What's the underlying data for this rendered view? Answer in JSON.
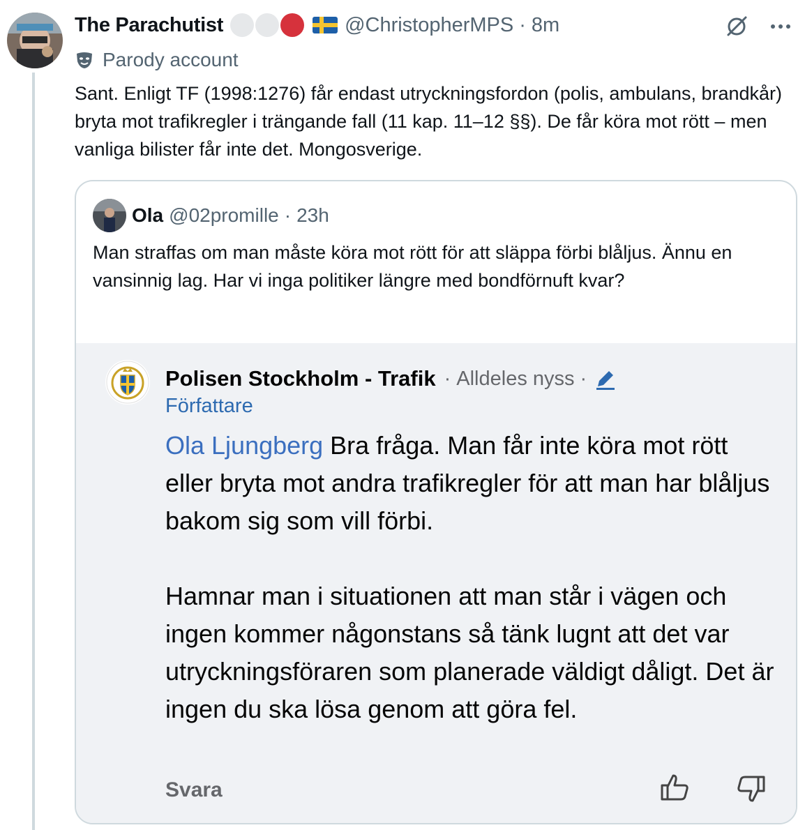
{
  "tweet": {
    "display_name": "The Parachutist",
    "handle": "@ChristopherMPS",
    "separator": "·",
    "time": "8m",
    "parody_label": "Parody account",
    "text": "Sant. Enligt TF (1998:1276) får endast utryckningsfordon (polis, ambulans, brandkår) bryta mot trafikregler i trängande fall (11 kap. 11–12 §§). De får köra mot rött  – men vanliga bilister får inte det. Mongosverige."
  },
  "quoted": {
    "display_name": "Ola",
    "handle": "@02promille",
    "separator": "·",
    "time": "23h",
    "text": "Man straffas om man måste köra mot rött för att släppa förbi blåljus. Ännu en vansinnig lag. Har vi inga politiker längre med bondförnuft kvar?"
  },
  "embedded_comment": {
    "author": "Polisen Stockholm - Trafik",
    "separator": "·",
    "time": "Alldeles nyss",
    "separator2": "·",
    "author_badge": "Författare",
    "mention": "Ola Ljungberg",
    "text_p1": " Bra fråga. Man får inte köra mot rött eller bryta mot andra trafikregler för att man har blåljus bakom sig som vill förbi.",
    "text_p2": "Hamnar man i situationen att man står i vägen och ingen kommer någonstans så tänk lugnt att det var utryckningsföraren som planerade väldigt dåligt. Det är ingen du ska lösa genom att göra fel.",
    "reply_label": "Svara"
  },
  "icons": {
    "grok": "grok-icon",
    "more": "more-icon",
    "parody": "parody-mask-icon",
    "flag": "sweden-flag-icon",
    "pencil": "edit-pencil-icon",
    "like": "thumbs-up-icon",
    "dislike": "thumbs-down-icon"
  },
  "colors": {
    "link_blue": "#3b6fbf",
    "secondary_gray": "#536471",
    "embedded_bg": "#f0f2f5",
    "label_red": "#d6323c"
  }
}
